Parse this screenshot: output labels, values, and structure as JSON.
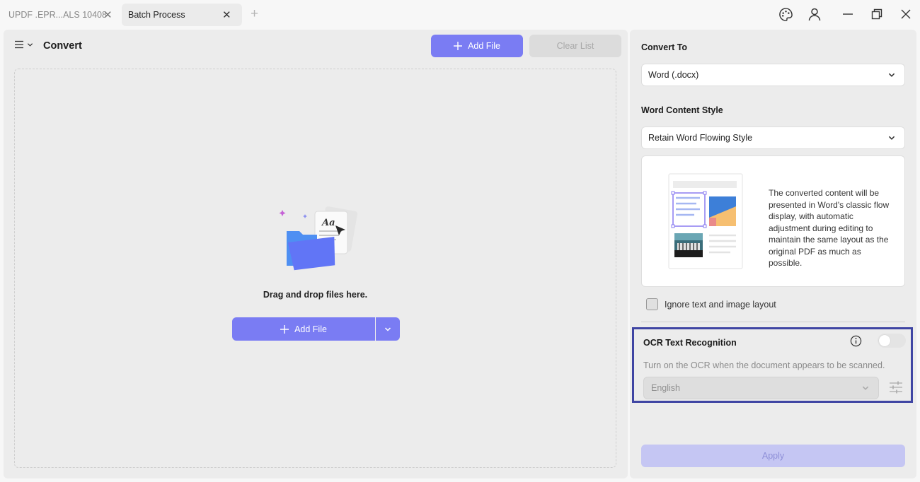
{
  "tabs": [
    {
      "label": "UPDF .EPR...ALS 10408",
      "active": false
    },
    {
      "label": "Batch Process",
      "active": true
    }
  ],
  "window_controls": [
    "palette-icon",
    "user-icon",
    "minimize-icon",
    "restore-icon",
    "close-icon"
  ],
  "left_panel": {
    "title": "Convert",
    "add_file_label": "Add File",
    "clear_list_label": "Clear List",
    "drop_text": "Drag and drop files here.",
    "illustration_text": "Aa"
  },
  "right_panel": {
    "convert_to_label": "Convert To",
    "convert_to_value": "Word (.docx)",
    "content_style_label": "Word Content Style",
    "content_style_value": "Retain Word Flowing Style",
    "style_description": "The converted content will be presented in Word's classic flow display, with automatic adjustment during editing to maintain the same layout as the original PDF as much as possible.",
    "ignore_layout_label": "Ignore text and image layout",
    "ignore_layout_checked": false,
    "ocr": {
      "title": "OCR Text Recognition",
      "enabled": false,
      "hint": "Turn on the OCR when the document appears to be scanned.",
      "language": "English"
    },
    "apply_label": "Apply"
  },
  "colors": {
    "primary": "#7a7cf3",
    "primary_disabled": "#c5c6f3",
    "highlight_border": "#3f45a3",
    "panel_bg": "#ececec"
  }
}
